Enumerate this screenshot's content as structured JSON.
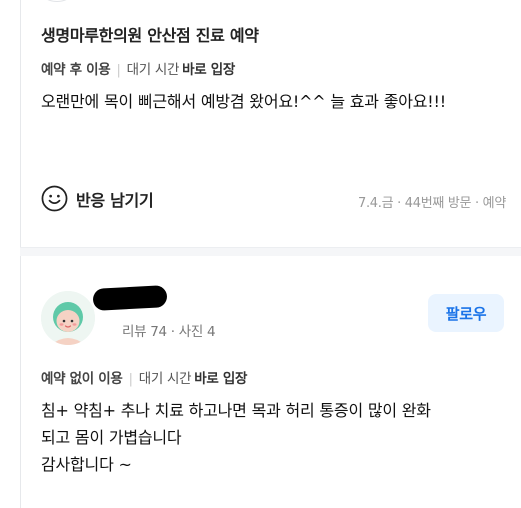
{
  "review1": {
    "place_name": "생명마루한의원 안산점 진료 예약",
    "reservation": "예약 후 이용",
    "wait_label": "대기 시간",
    "wait_value": "바로 입장",
    "text": "오랜만에 목이 삐근해서 예방겸 왔어요!^^ 늘 효과 좋아요!!!",
    "reaction_label": "반응 남기기",
    "visit_info": "7.4.금 · 44번째 방문 · 예약"
  },
  "review2": {
    "user_stats": "리뷰 74 · 사진 4",
    "follow_label": "팔로우",
    "reservation": "예약 없이 이용",
    "wait_label": "대기 시간",
    "wait_value": "바로 입장",
    "text_lines": [
      "침+ 약침+ 추나 치료 하고나면 목과 허리 통증이 많이 완화",
      "되고 몸이 가볍습니다",
      "감사합니다 ~"
    ]
  },
  "colors": {
    "accent": "#1a73e8",
    "follow_bg": "#eaf4ff",
    "avatar_hair": "#5fc9a8"
  },
  "icons": [
    "smile-icon",
    "user-avatar"
  ]
}
